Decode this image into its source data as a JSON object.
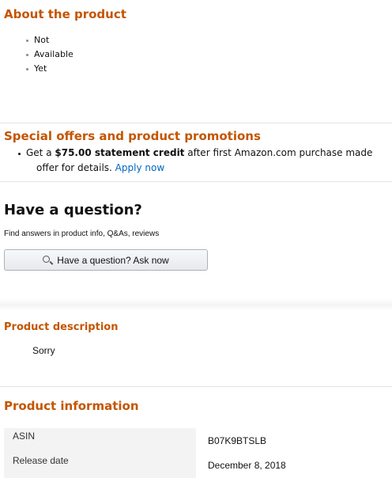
{
  "about": {
    "heading": "About the product",
    "bullets": [
      "Not",
      "Available",
      "Yet"
    ]
  },
  "offers": {
    "heading": "Special offers and product promotions",
    "line1_prefix": "Get a ",
    "line1_bold": "$75.00 statement credit",
    "line1_suffix": " after first Amazon.com purchase made",
    "line2_text": "offer for details. ",
    "apply_link": "Apply now"
  },
  "question": {
    "heading": "Have a question?",
    "subtext": "Find answers in product info, Q&As, reviews",
    "button_label": "Have a question? Ask now"
  },
  "description": {
    "heading": "Product description",
    "text": "Sorry"
  },
  "info": {
    "heading": "Product information",
    "rows": [
      {
        "label": "ASIN",
        "value": "B07K9BTSLB"
      },
      {
        "label": "Release date",
        "value": "December 8, 2018"
      }
    ]
  },
  "colors": {
    "heading_orange": "#c45500",
    "link_blue": "#0066c0"
  }
}
